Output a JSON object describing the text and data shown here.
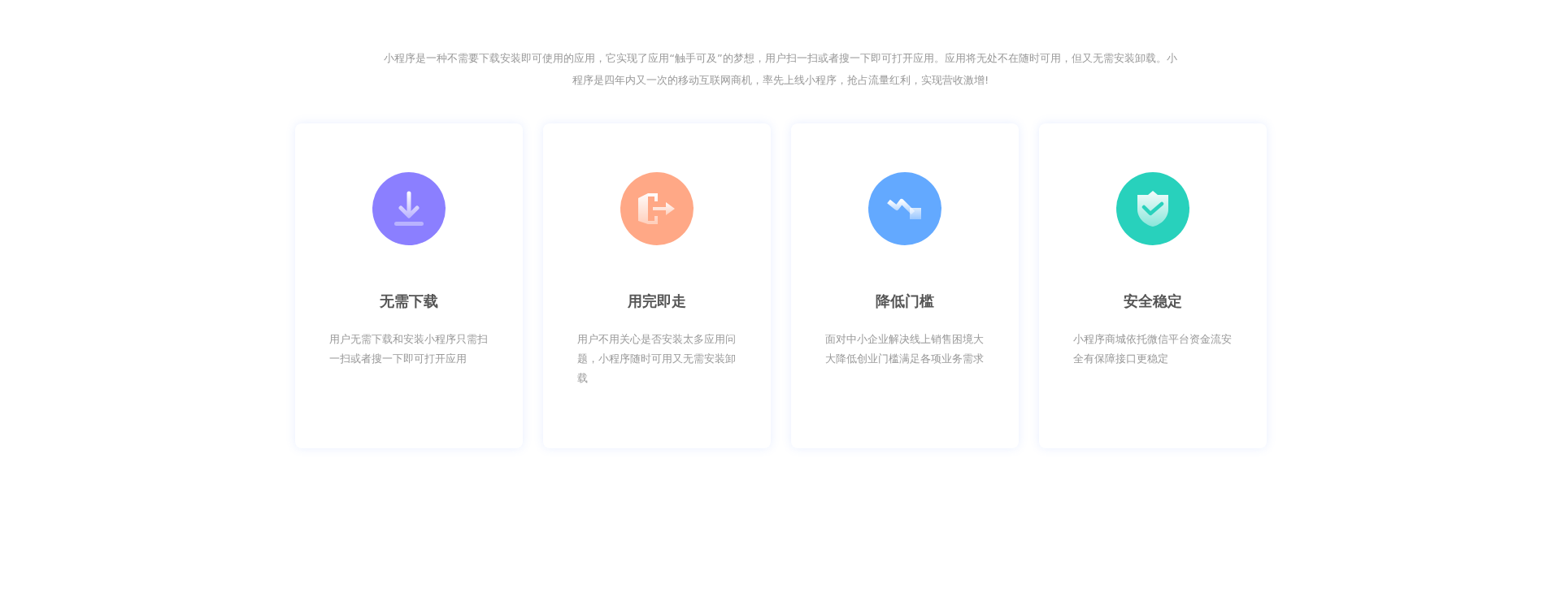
{
  "intro": "小程序是一种不需要下载安装即可使用的应用，它实现了应用“触手可及”的梦想，用户扫一扫或者搜一下即可打开应用。应用将无处不在随时可用，但又无需安装卸载。小程序是四年内又一次的移动互联网商机，率先上线小程序，抢占流量红利，实现营收激增!",
  "features": [
    {
      "kind": "download",
      "color": "#8b7fff",
      "title": "无需下载",
      "description": "用户无需下载和安装小程序只需扫一扫或者搜一下即可打开应用"
    },
    {
      "kind": "exit",
      "color": "#ffa886",
      "title": "用完即走",
      "description": "用户不用关心是否安装太多应用问题，小程序随时可用又无需安装卸载"
    },
    {
      "kind": "trend",
      "color": "#63a9ff",
      "title": "降低门槛",
      "description": "面对中小企业解决线上销售困境大大降低创业门槛满足各项业务需求"
    },
    {
      "kind": "shield",
      "color": "#28d1bc",
      "title": "安全稳定",
      "description": "小程序商城依托微信平台资金流安全有保障接口更稳定"
    }
  ]
}
